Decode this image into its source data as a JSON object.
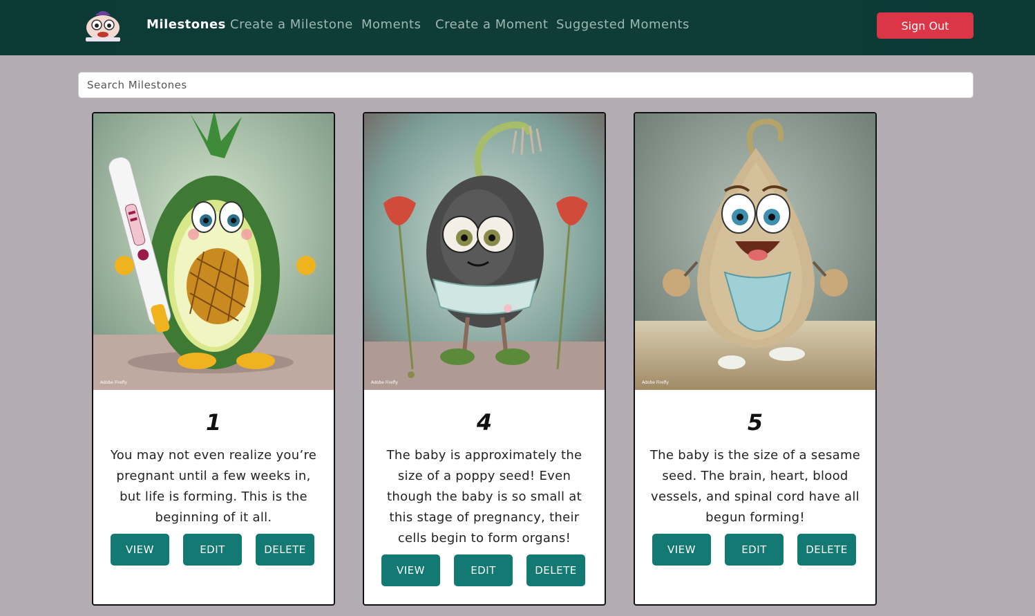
{
  "nav": {
    "items": [
      {
        "label": "Milestones",
        "active": true
      },
      {
        "label": "Create a Milestone",
        "active": false
      },
      {
        "label": "Moments",
        "active": false
      },
      {
        "label": "Create a Moment",
        "active": false
      },
      {
        "label": "Suggested Moments",
        "active": false
      }
    ],
    "signout_label": "Sign Out"
  },
  "search": {
    "placeholder": "Search Milestones",
    "value": ""
  },
  "cards": [
    {
      "week": "1",
      "text": "You may not even realize you’re pregnant until a few weeks in, but life is forming. This is the beginning of it all.",
      "image_icon": "pineapple-avocado-character"
    },
    {
      "week": "4",
      "text": "The baby is approximately the size of a poppy seed! Even though the baby is so small at this stage of pregnancy, their cells begin to form organs!",
      "image_icon": "poppy-seed-character"
    },
    {
      "week": "5",
      "text": "The baby is the size of a sesame seed. The brain, heart, blood vessels, and spinal cord have all begun forming!",
      "image_icon": "sesame-seed-character"
    }
  ],
  "buttons": {
    "view": "VIEW",
    "edit": "EDIT",
    "delete": "DELETE"
  },
  "colors": {
    "navbar": "#0f3c37",
    "background": "#b3acb2",
    "action_button": "#127a73",
    "signout": "#dc3545"
  }
}
